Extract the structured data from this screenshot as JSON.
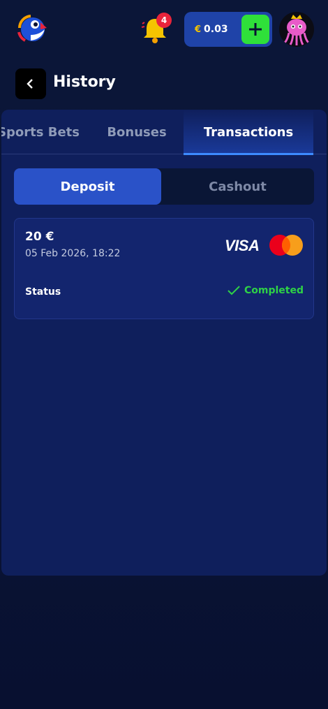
{
  "header": {
    "logo_icon": "parrot-logo-icon",
    "notifications": {
      "icon": "bell-icon",
      "count": "4"
    },
    "balance": {
      "currency": "€",
      "amount": "0.03",
      "add_icon": "plus-icon"
    },
    "avatar_icon": "jellyfish-avatar"
  },
  "page": {
    "title": "History",
    "back_icon": "chevron-left-icon"
  },
  "tabs": [
    {
      "label": "Sports Bets",
      "active": false
    },
    {
      "label": "Bonuses",
      "active": false
    },
    {
      "label": "Transactions",
      "active": true
    }
  ],
  "segments": {
    "deposit": "Deposit",
    "cashout": "Cashout",
    "selected": "Deposit"
  },
  "transactions": [
    {
      "amount": "20 €",
      "date": "05 Feb 2026, 18:22",
      "payment_brand": "VISA",
      "status_label": "Status",
      "status_value": "Completed"
    }
  ],
  "colors": {
    "accent_blue": "#2a52c8",
    "success_green": "#2ed246",
    "add_button_green": "#2fe03a",
    "badge_red": "#e8243b",
    "currency_gold": "#f5c400"
  }
}
